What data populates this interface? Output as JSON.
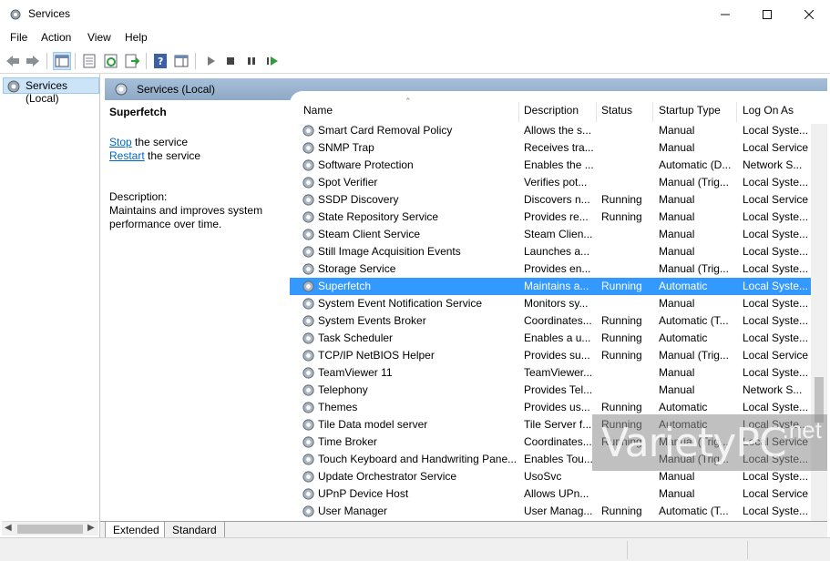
{
  "window": {
    "title": "Services"
  },
  "menu": [
    "File",
    "Action",
    "View",
    "Help"
  ],
  "tree": {
    "selected": "Services (Local)"
  },
  "pane_header": "Services (Local)",
  "detail": {
    "title": "Superfetch",
    "stop_link": "Stop",
    "stop_rest": " the service",
    "restart_link": "Restart",
    "restart_rest": " the service",
    "description_label": "Description:",
    "description": "Maintains and improves system performance over time."
  },
  "columns": [
    "Name",
    "Description",
    "Status",
    "Startup Type",
    "Log On As"
  ],
  "services": [
    {
      "name": "Smart Card Removal Policy",
      "desc": "Allows the s...",
      "status": "",
      "startup": "Manual",
      "logon": "Local Syste..."
    },
    {
      "name": "SNMP Trap",
      "desc": "Receives tra...",
      "status": "",
      "startup": "Manual",
      "logon": "Local Service"
    },
    {
      "name": "Software Protection",
      "desc": "Enables the ...",
      "status": "",
      "startup": "Automatic (D...",
      "logon": "Network S..."
    },
    {
      "name": "Spot Verifier",
      "desc": "Verifies pot...",
      "status": "",
      "startup": "Manual (Trig...",
      "logon": "Local Syste..."
    },
    {
      "name": "SSDP Discovery",
      "desc": "Discovers n...",
      "status": "Running",
      "startup": "Manual",
      "logon": "Local Service"
    },
    {
      "name": "State Repository Service",
      "desc": "Provides re...",
      "status": "Running",
      "startup": "Manual",
      "logon": "Local Syste..."
    },
    {
      "name": "Steam Client Service",
      "desc": "Steam Clien...",
      "status": "",
      "startup": "Manual",
      "logon": "Local Syste..."
    },
    {
      "name": "Still Image Acquisition Events",
      "desc": "Launches a...",
      "status": "",
      "startup": "Manual",
      "logon": "Local Syste..."
    },
    {
      "name": "Storage Service",
      "desc": "Provides en...",
      "status": "",
      "startup": "Manual (Trig...",
      "logon": "Local Syste..."
    },
    {
      "name": "Superfetch",
      "desc": "Maintains a...",
      "status": "Running",
      "startup": "Automatic",
      "logon": "Local Syste...",
      "selected": true
    },
    {
      "name": "System Event Notification Service",
      "desc": "Monitors sy...",
      "status": "",
      "startup": "Manual",
      "logon": "Local Syste..."
    },
    {
      "name": "System Events Broker",
      "desc": "Coordinates...",
      "status": "Running",
      "startup": "Automatic (T...",
      "logon": "Local Syste..."
    },
    {
      "name": "Task Scheduler",
      "desc": "Enables a u...",
      "status": "Running",
      "startup": "Automatic",
      "logon": "Local Syste..."
    },
    {
      "name": "TCP/IP NetBIOS Helper",
      "desc": "Provides su...",
      "status": "Running",
      "startup": "Manual (Trig...",
      "logon": "Local Service"
    },
    {
      "name": "TeamViewer 11",
      "desc": "TeamViewer...",
      "status": "",
      "startup": "Manual",
      "logon": "Local Syste..."
    },
    {
      "name": "Telephony",
      "desc": "Provides Tel...",
      "status": "",
      "startup": "Manual",
      "logon": "Network S..."
    },
    {
      "name": "Themes",
      "desc": "Provides us...",
      "status": "Running",
      "startup": "Automatic",
      "logon": "Local Syste..."
    },
    {
      "name": "Tile Data model server",
      "desc": "Tile Server f...",
      "status": "Running",
      "startup": "Automatic",
      "logon": "Local Syste..."
    },
    {
      "name": "Time Broker",
      "desc": "Coordinates...",
      "status": "Running",
      "startup": "Manual (Trig...",
      "logon": "Local Service"
    },
    {
      "name": "Touch Keyboard and Handwriting Pane...",
      "desc": "Enables Tou...",
      "status": "",
      "startup": "Manual (Trig...",
      "logon": "Local Syste..."
    },
    {
      "name": "Update Orchestrator Service",
      "desc": "UsoSvc",
      "status": "",
      "startup": "Manual",
      "logon": "Local Syste..."
    },
    {
      "name": "UPnP Device Host",
      "desc": "Allows UPn...",
      "status": "",
      "startup": "Manual",
      "logon": "Local Service"
    },
    {
      "name": "User Manager",
      "desc": "User Manag...",
      "status": "Running",
      "startup": "Automatic (T...",
      "logon": "Local Syste..."
    }
  ],
  "tabs": [
    "Extended",
    "Standard"
  ],
  "watermark": {
    "brand": "VarietyPC",
    "tld": ".net"
  }
}
